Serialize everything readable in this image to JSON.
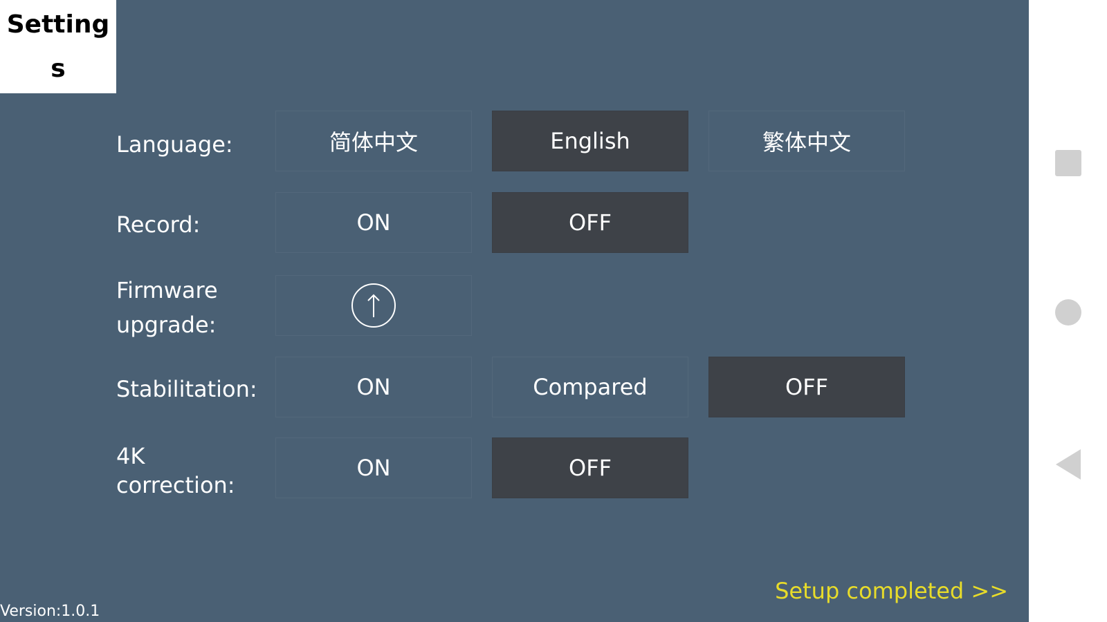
{
  "app": {
    "title": "Settings"
  },
  "rows": {
    "language": {
      "label": "Language:",
      "options": [
        "简体中文",
        "English",
        "繁体中文"
      ],
      "selected": "English"
    },
    "record": {
      "label": "Record:",
      "options": [
        "ON",
        "OFF"
      ],
      "selected": "OFF"
    },
    "firmware": {
      "label_line1": "Firmware",
      "label_line2": "upgrade:",
      "action_icon": "upload-arrow-icon"
    },
    "stabilitation": {
      "label": "Stabilitation:",
      "options": [
        "ON",
        "Compared",
        "OFF"
      ],
      "selected": "OFF"
    },
    "k4": {
      "label_line1": "4K",
      "label_line2": "correction:",
      "options": [
        "ON",
        "OFF"
      ],
      "selected": "OFF"
    }
  },
  "footer": {
    "setup_completed": "Setup completed >>",
    "version": "Version:1.0.1"
  },
  "nav": {
    "icons": [
      "square-icon",
      "circle-icon",
      "back-triangle-icon"
    ]
  },
  "colors": {
    "background": "#4a6074",
    "selected": "#3e4248",
    "accent": "#e8dc2a"
  }
}
